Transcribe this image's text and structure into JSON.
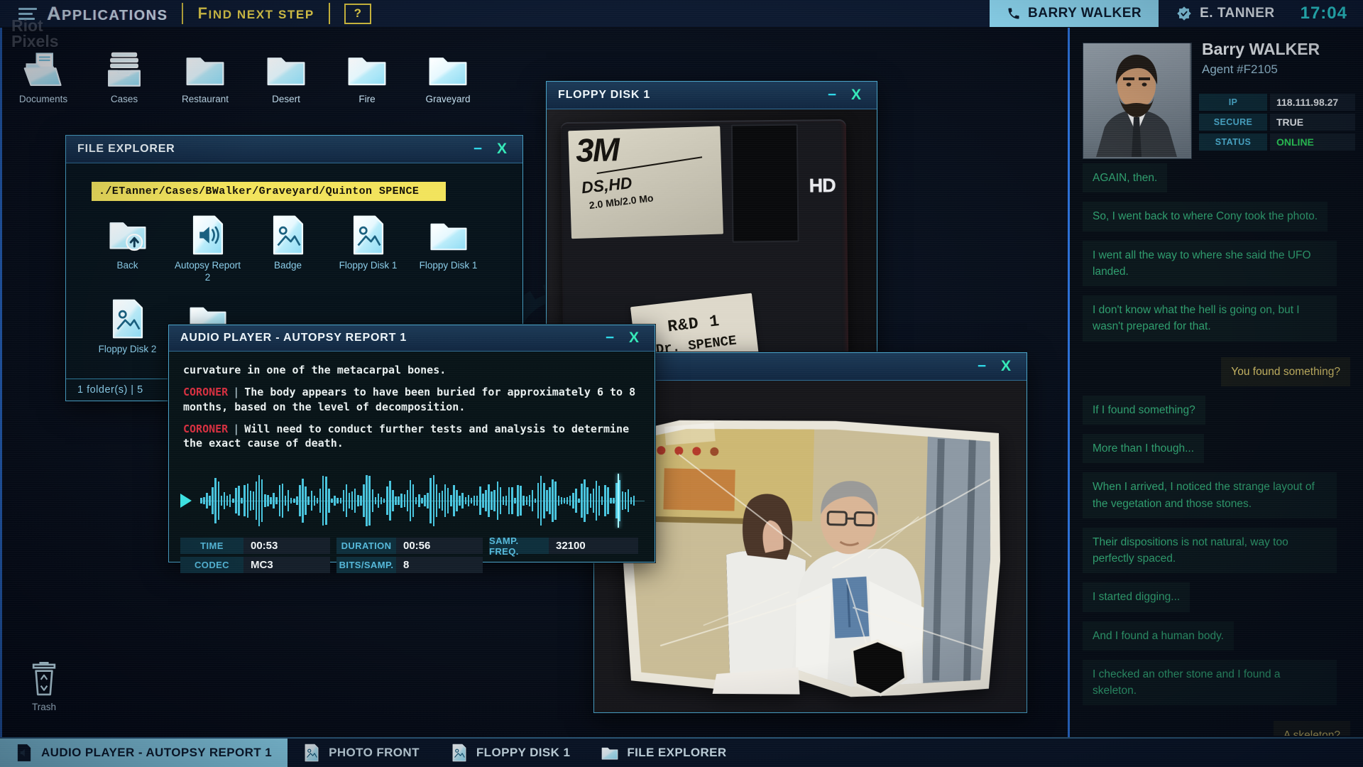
{
  "topbar": {
    "menu_label": "APPLICATIONS",
    "find_next_step_label": "FIND NEXT STEP",
    "help_label": "?",
    "tabs": [
      {
        "label": "BARRY WALKER",
        "active": true
      },
      {
        "label": "E. TANNER",
        "active": false
      }
    ],
    "clock": "17:04"
  },
  "watermark": {
    "line1": "Riot",
    "line2": "Pixels"
  },
  "desktop_icons": [
    {
      "label": "Documents",
      "type": "open-folder"
    },
    {
      "label": "Cases",
      "type": "tray"
    },
    {
      "label": "Restaurant",
      "type": "folder"
    },
    {
      "label": "Desert",
      "type": "folder"
    },
    {
      "label": "Fire",
      "type": "folder"
    },
    {
      "label": "Graveyard",
      "type": "folder"
    }
  ],
  "trash": {
    "label": "Trash"
  },
  "window_controls": {
    "minimize": "−",
    "close": "X"
  },
  "file_explorer": {
    "title": "FILE EXPLORER",
    "path": "./ETanner/Cases/BWalker/Graveyard/Quinton SPENCE",
    "items": [
      {
        "label": "Back",
        "type": "folder-back"
      },
      {
        "label": "Autopsy Report 2",
        "type": "audio-file"
      },
      {
        "label": "Badge",
        "type": "image-file"
      },
      {
        "label": "Floppy Disk 1",
        "type": "image-file"
      },
      {
        "label": "Floppy Disk 1",
        "type": "folder"
      },
      {
        "label": "Floppy Disk 2",
        "type": "image-file"
      },
      {
        "label": "",
        "type": "folder"
      }
    ],
    "status": "1 folder(s)   |   5"
  },
  "floppy_window": {
    "title": "FLOPPY DISK 1",
    "disk": {
      "brand": "3M",
      "format": "DS,HD",
      "capacity": "2.0 Mb/2.0 Mo",
      "hd_mark": "HD",
      "label_line1": "R&D 1",
      "label_line2": "Dr. SPENCE"
    }
  },
  "audio_player": {
    "title": "AUDIO PLAYER - AUTOPSY REPORT 1",
    "transcript": [
      {
        "speaker": "",
        "sep": "",
        "text": "curvature in one of the metacarpal bones."
      },
      {
        "speaker": "CORONER",
        "sep": "|",
        "text": "The body appears to have been buried for approximately 6 to 8 months, based on the level of decomposition."
      },
      {
        "speaker": "CORONER",
        "sep": "|",
        "text": "Will need to conduct further tests and analysis to determine the exact cause of death."
      }
    ],
    "stats": {
      "time_label": "TIME",
      "time_value": "00:53",
      "duration_label": "DURATION",
      "duration_value": "00:56",
      "freq_label": "SAMP. FREQ.",
      "freq_value": "32100",
      "codec_label": "CODEC",
      "codec_value": "MC3",
      "bits_label": "BITS/SAMP.",
      "bits_value": "8"
    },
    "progress_pct": 94
  },
  "sidebar": {
    "profile": {
      "name": "Barry WALKER",
      "subtitle": "Agent #F2105",
      "fields": [
        {
          "label": "IP",
          "value": "118.111.98.27"
        },
        {
          "label": "SECURE",
          "value": "TRUE"
        },
        {
          "label": "STATUS",
          "value": "ONLINE"
        }
      ]
    },
    "messages": [
      {
        "from": "contact",
        "text": "AGAIN, then."
      },
      {
        "from": "contact",
        "text": "So, I went back to where Cony took the photo."
      },
      {
        "from": "contact",
        "text": "I went all the way to where she said the UFO landed."
      },
      {
        "from": "contact",
        "text": "I don't know what the hell is going on, but I wasn't prepared for that."
      },
      {
        "from": "player",
        "text": "You found something?"
      },
      {
        "from": "contact",
        "text": "If I found something?"
      },
      {
        "from": "contact",
        "text": "More than I though..."
      },
      {
        "from": "contact",
        "text": "When I arrived, I noticed the strange layout of the vegetation and those stones."
      },
      {
        "from": "contact",
        "text": "Their dispositions is not natural, way too perfectly spaced."
      },
      {
        "from": "contact",
        "text": "I started digging..."
      },
      {
        "from": "contact",
        "text": "And I found a human body."
      },
      {
        "from": "contact",
        "text": "I checked an other stone and I found a skeleton."
      },
      {
        "from": "player",
        "text": "A skeleton?"
      }
    ]
  },
  "taskbar": {
    "items": [
      {
        "label": "AUDIO PLAYER - AUTOPSY REPORT 1",
        "icon": "audio-file-icon",
        "active": true
      },
      {
        "label": "PHOTO FRONT",
        "icon": "image-file-icon",
        "active": false
      },
      {
        "label": "FLOPPY DISK 1",
        "icon": "image-file-icon",
        "active": false
      },
      {
        "label": "FILE EXPLORER",
        "icon": "folder-icon",
        "active": false
      }
    ]
  },
  "colors": {
    "accent_cyan": "#8ed9f2",
    "accent_yellow": "#e9d44c",
    "status_online": "#2ed65a",
    "coroner_red": "#d63040",
    "chat_green": "#2f9e6e",
    "chat_yellow": "#c9b763"
  }
}
